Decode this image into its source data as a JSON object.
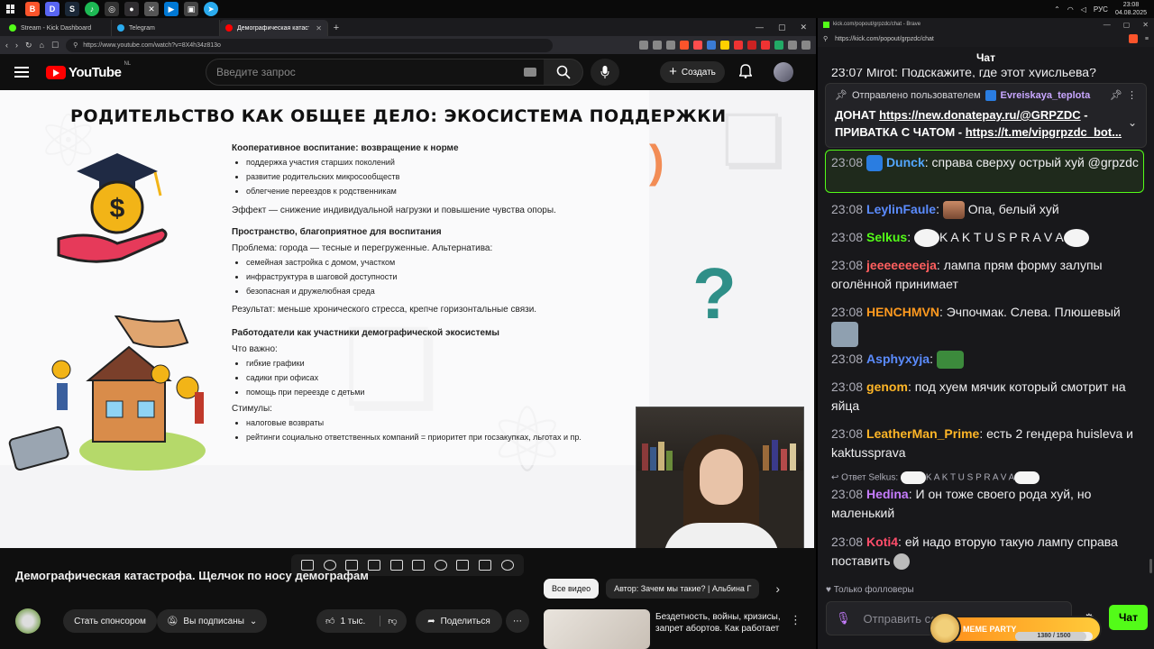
{
  "taskbar": {
    "lang": "РУС",
    "time": "23:08",
    "date": "04.08.2025"
  },
  "browser": {
    "tabs": [
      {
        "label": "Stream - Kick Dashboard",
        "color": "#53fc18"
      },
      {
        "label": "Telegram",
        "color": "#2aabee"
      },
      {
        "label": "Демографическая катастрофа",
        "color": "#ff0000"
      }
    ],
    "url": "https://www.youtube.com/watch?v=8X4h34z813o"
  },
  "youtube": {
    "logo_text": "YouTube",
    "country": "NL",
    "search_placeholder": "Введите запрос",
    "create_label": "Создать"
  },
  "slide": {
    "title": "РОДИТЕЛЬСТВО КАК ОБЩЕЕ ДЕЛО: ЭКОСИСТЕМА ПОДДЕРЖКИ",
    "s1_heading": "Кооперативное воспитание: возвращение к норме",
    "s1_items": [
      "поддержка участия старших поколений",
      "развитие родительских микросообществ",
      "облегчение переездов к родственникам"
    ],
    "s1_effect": "Эффект — снижение индивидуальной нагрузки и повышение чувства опоры.",
    "s2_heading": "Пространство, благоприятное для воспитания",
    "s2_problem": "Проблема: города — тесные и перегруженные. Альтернатива:",
    "s2_items": [
      "семейная застройка с домом, участком",
      "инфраструктура в шаговой доступности",
      "безопасная и дружелюбная среда"
    ],
    "s2_result": "Результат: меньше хронического стресса, крепче горизонтальные связи.",
    "s3_heading": "Работодатели как участники демографической экосистемы",
    "s3_important": "Что важно:",
    "s3_items": [
      "гибкие графики",
      "садики при офисах",
      "помощь при переезде с детьми"
    ],
    "s3_stimuli": "Стимулы:",
    "s3_items2": [
      "налоговые возвраты",
      "рейтинги социально ответственных компаний = приоритет при госзакупках, льготах и пр."
    ]
  },
  "video": {
    "title": "Демографическая катастрофа. Щелчок по носу демографам",
    "sponsor_label": "Стать спонсором",
    "subscribed_label": "Вы подписаны",
    "likes": "1 тыс.",
    "share_label": "Поделиться"
  },
  "recommendations": {
    "chip_all": "Все видео",
    "chip_author": "Автор: Зачем мы такие? | Альбина Г",
    "rec_title": "Бездетность, войны, кризисы, запрет абортов. Как работает"
  },
  "chat_window": {
    "title": "kick.com/popout/grpzdc/chat - Brave",
    "url": "https://kick.com/popout/grpzdc/chat",
    "header": "Чат",
    "pinned_by": "Отправлено пользователем",
    "pinned_user": "Evreiskaya_teplota",
    "pinned_line1_prefix": "ДОНАТ ",
    "pinned_link1": "https://new.donatepay.ru/@GRPZDC",
    "pinned_line1_suffix": " -",
    "pinned_line2_prefix": "ПРИВАТКА С ЧАТОМ - ",
    "pinned_link2": "https://t.me/vipgrpzdc_bot...",
    "top_partial": "23:07 Mirot: Подскажите, где этот хуисльева?",
    "messages": [
      {
        "ts": "23:08",
        "user": "Dunck",
        "color": "#53a7ff",
        "text": "справа сверху острый хуй @grpzdc"
      },
      {
        "ts": "23:08",
        "user": "LeylinFaule",
        "color": "#5b8cff",
        "text": "Опа, белый хуй"
      },
      {
        "ts": "23:08",
        "user": "Selkus",
        "color": "#53fc18",
        "text": "K A K T U S P R A V A"
      },
      {
        "ts": "23:08",
        "user": "jeeeeeeeeja",
        "color": "#ff5f5f",
        "text": "лампа прям форму залупы оголённой принимает"
      },
      {
        "ts": "23:08",
        "user": "HENCHMVN",
        "color": "#ff9a1f",
        "text": "Эчпочмак. Слева. Плюшевый"
      },
      {
        "ts": "23:08",
        "user": "Asphyxyja",
        "color": "#5b8cff",
        "text": ""
      },
      {
        "ts": "23:08",
        "user": "genom",
        "color": "#ffb627",
        "text": "под хуем мячик который смотрит на яйца"
      },
      {
        "ts": "23:08",
        "user": "LeatherMan_Prime",
        "color": "#ffb627",
        "text": "есть 2 гендера huisleva и kaktussprava"
      },
      {
        "ts": "23:08",
        "user": "Hedina",
        "color": "#c77dff",
        "text": "И он тоже своего рода хуй, но маленький"
      },
      {
        "ts": "23:08",
        "user": "Koti4",
        "color": "#ff4d6a",
        "text": "ей надо вторую такую лампу справа поставить"
      }
    ],
    "reply_prefix": "Ответ Selkus:",
    "reply_text": "K A K T U S P R A V A",
    "followers_only": "Только фолловеры",
    "input_placeholder": "Отправить сообщение",
    "send_label": "Чат",
    "meme_party_label": "MEME PARTY",
    "meme_party_progress": "1380 / 1500",
    "meme_party_fill": 0.92
  }
}
